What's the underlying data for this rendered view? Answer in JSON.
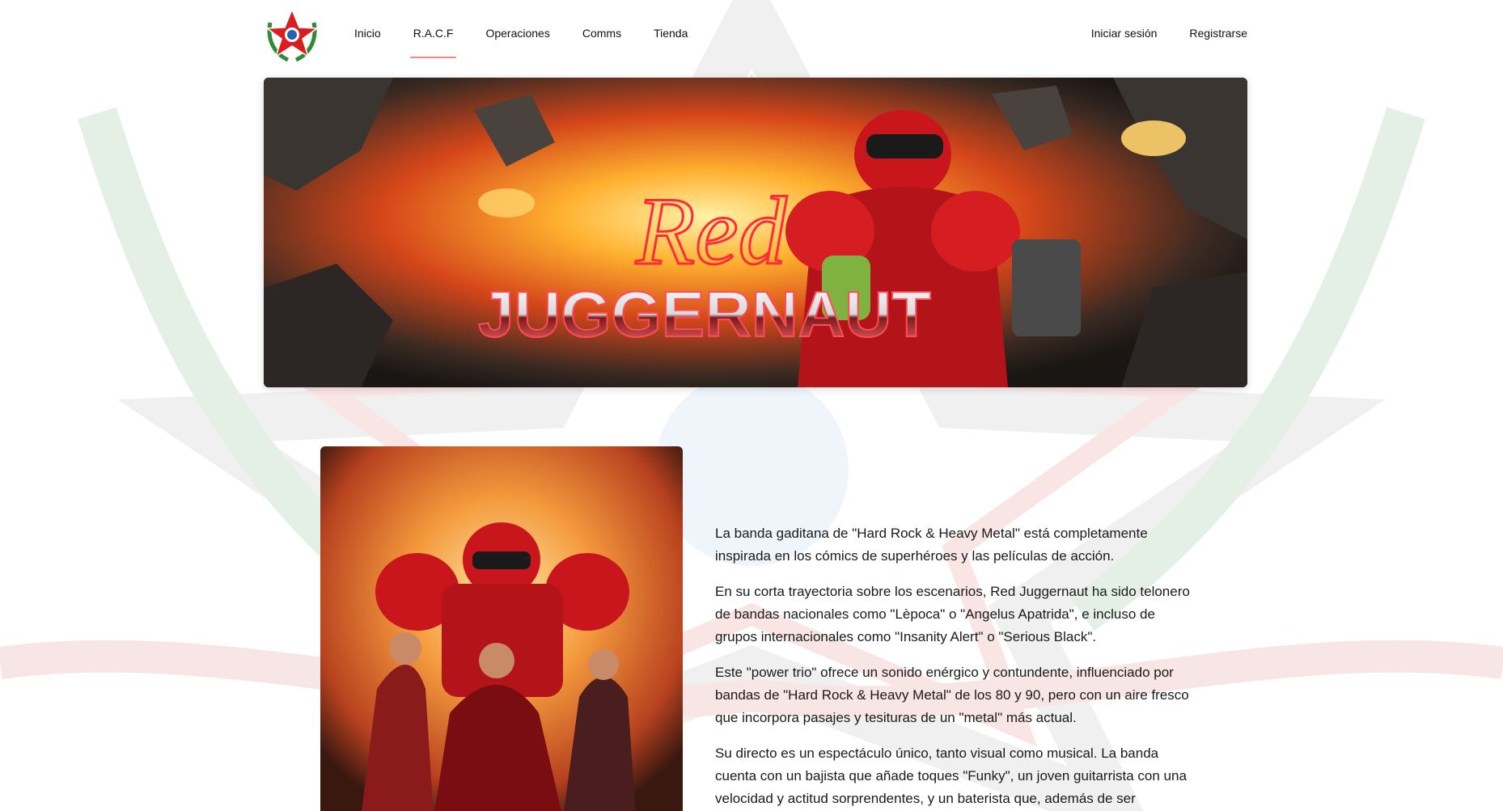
{
  "nav": {
    "items": [
      {
        "label": "Inicio",
        "active": false
      },
      {
        "label": "R.A.C.F",
        "active": true
      },
      {
        "label": "Operaciones",
        "active": false
      },
      {
        "label": "Comms",
        "active": false
      },
      {
        "label": "Tienda",
        "active": false
      }
    ],
    "login_label": "Iniciar sesión",
    "register_label": "Registrarse"
  },
  "banner": {
    "title_script": "Red",
    "title_main": "JUGGERNAUT"
  },
  "content": {
    "paragraphs": [
      "La banda gaditana de \"Hard Rock & Heavy Metal\" está completamente inspirada en los cómics de superhéroes y las películas de acción.",
      "En su corta trayectoria sobre los escenarios, Red Juggernaut ha sido telonero de bandas nacionales como \"Lèpoca\" o \"Angelus Apatrida\", e incluso de grupos internacionales como \"Insanity Alert\" o \"Serious Black\".",
      "Este \"power trio\" ofrece un sonido enérgico y contundente, influenciado por bandas de \"Hard Rock & Heavy Metal\" de los 80 y 90, pero con un aire fresco que incorpora pasajes y tesituras de un \"metal\" más actual.",
      "Su directo es un espectáculo único, tanto visual como musical. La banda cuenta con un bajista que añade toques \"Funky\", un joven guitarrista con una velocidad y actitud sorprendentes, y un baterista que, además de ser"
    ]
  },
  "colors": {
    "accent": "#f08a8a",
    "brand_red": "#d81e1e",
    "brand_green": "#2e8b3a"
  },
  "icons": {
    "logo": "star-emblem-logo"
  }
}
